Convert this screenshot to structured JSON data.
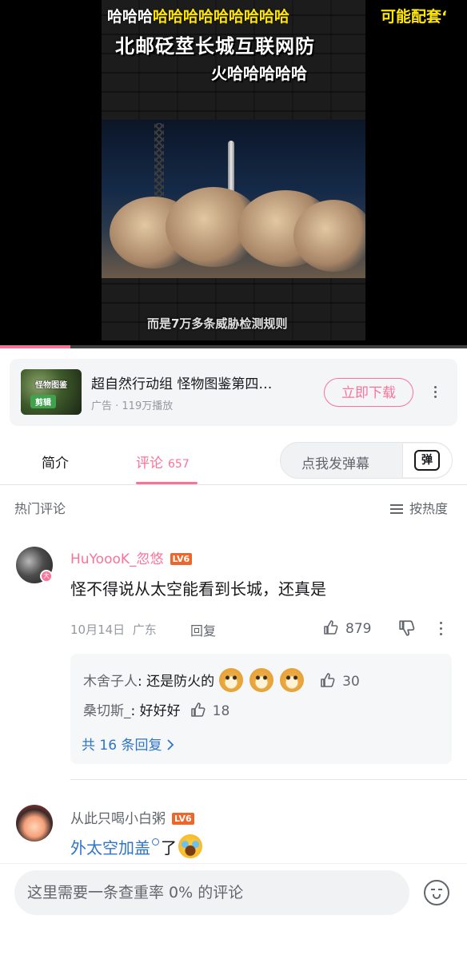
{
  "video": {
    "caption_top_left_white": "哈哈哈",
    "caption_top_left_yellow": "哈哈哈哈哈哈哈哈哈",
    "caption_top_right": "可能配套‘",
    "caption_title_line1": "北邮砭莖长城互联网防",
    "caption_title_line2": "火哈哈哈哈哈",
    "caption_subtitle": "而是7万多条威胁检测规则",
    "progress": 0.15
  },
  "ad": {
    "thumb_text": "怪物图鉴",
    "thumb_badge": "剪辑",
    "title": "超自然行动组 怪物图鉴第四…",
    "meta": "广告 · 119万播放",
    "download_label": "立即下载"
  },
  "tabs": {
    "intro_label": "简介",
    "comments_label": "评论",
    "comments_count": "657",
    "danmaku_placeholder": "点我发弹幕",
    "danmaku_icon_label": "弹"
  },
  "comments_header": {
    "hot_label": "热门评论",
    "sort_label": "按热度"
  },
  "comments": [
    {
      "avatar_badge": "大",
      "username": "HuYoooK_忽悠",
      "level": "LV6",
      "text": "怪不得说从太空能看到长城，还真是",
      "date": "10月14日",
      "location": "广东",
      "reply_label": "回复",
      "likes": "879",
      "replies": [
        {
          "user": "木舍子人",
          "text": "还是防火的",
          "likes": "30"
        },
        {
          "user": "桑切斯_",
          "text": "好好好",
          "likes": "18"
        }
      ],
      "more_replies_label": "共 16 条回复"
    },
    {
      "username": "从此只喝小白粥",
      "level": "LV6",
      "text_link": "外太空加盖",
      "text_suffix": "了"
    }
  ],
  "input": {
    "placeholder": "这里需要一条查重率 0% 的评论"
  },
  "colors": {
    "accent": "#fb7299",
    "link": "#2e74c7",
    "level_badge": "#ee672a"
  }
}
